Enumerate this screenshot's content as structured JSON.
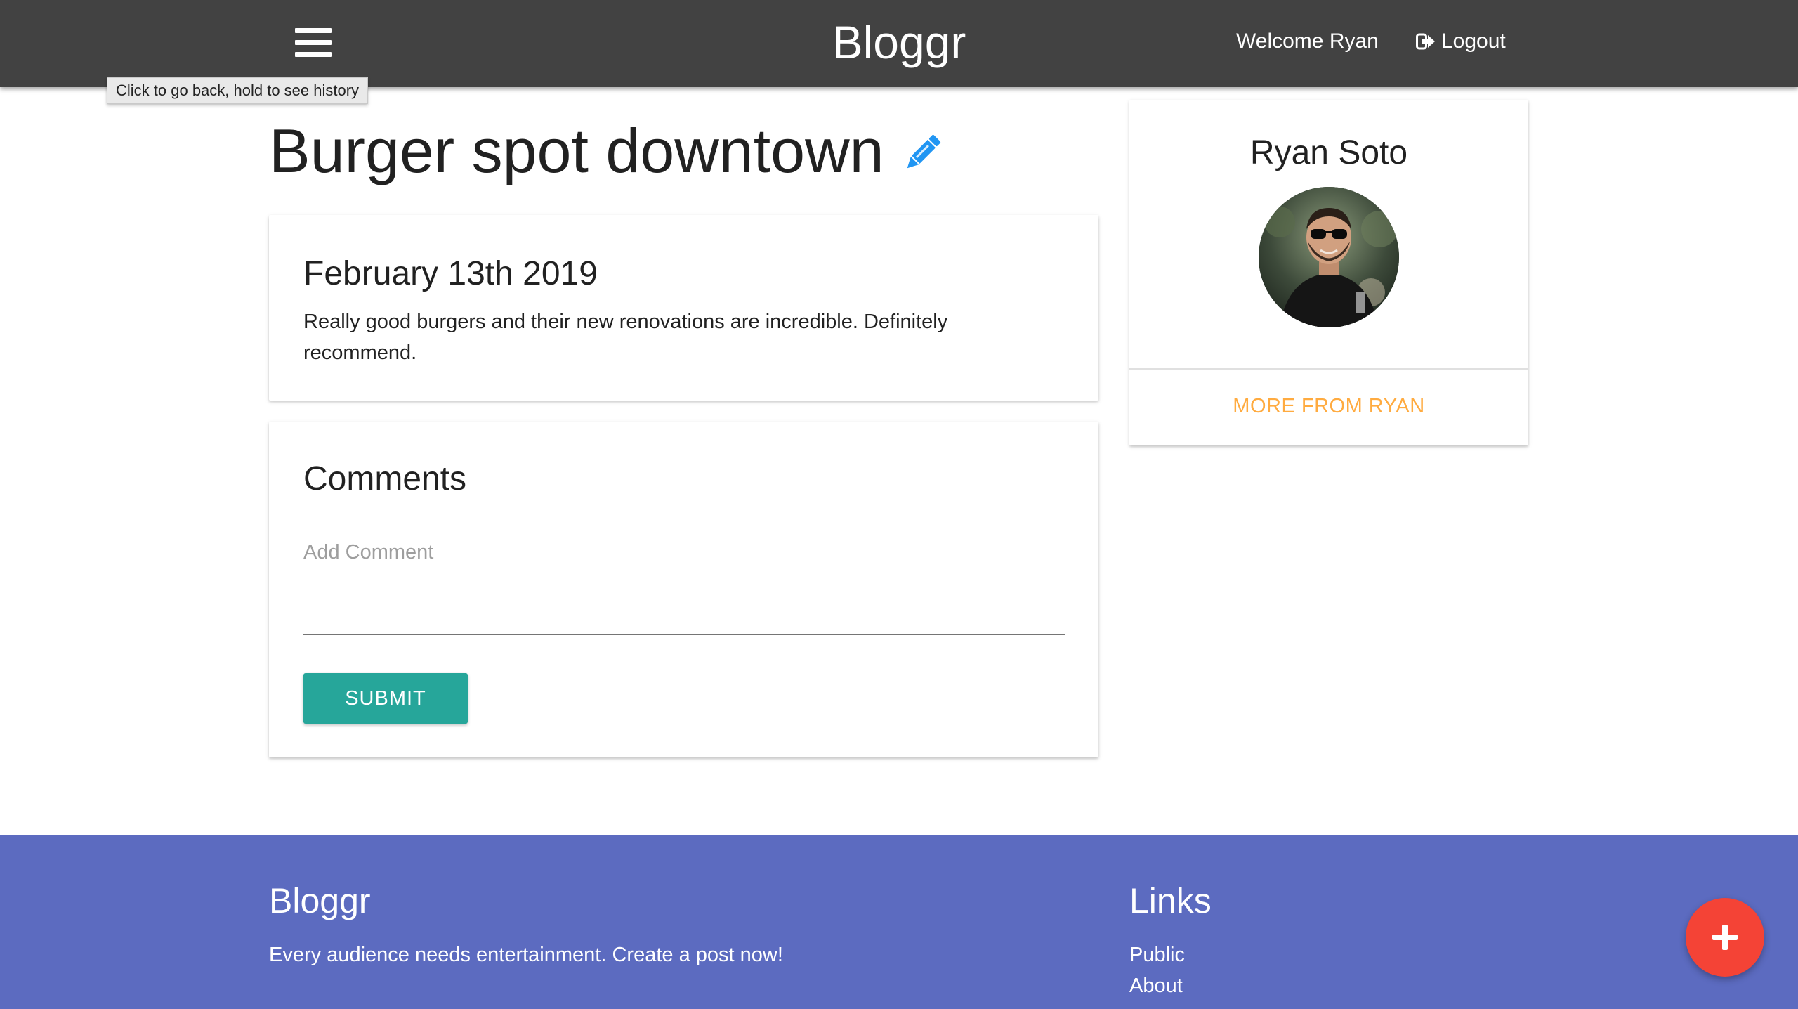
{
  "navbar": {
    "brand": "Bloggr",
    "welcome_text": "Welcome Ryan",
    "logout_label": "Logout",
    "menu_icon": "hamburger-menu-icon",
    "logout_icon": "sign-out-icon",
    "background_color": "#424242"
  },
  "tooltip": {
    "text": "Click to go back, hold to see history"
  },
  "post": {
    "title": "Burger spot downtown",
    "edit_icon": "pencil-icon",
    "date": "February 13th 2019",
    "body": "Really good burgers and their new renovations are incredible. Definitely recommend."
  },
  "comments": {
    "title": "Comments",
    "input_label": "Add Comment",
    "input_value": "",
    "submit_label": "SUBMIT",
    "submit_color": "#26a69a"
  },
  "author": {
    "name": "Ryan Soto",
    "avatar_icon": "profile-photo",
    "more_link": "MORE FROM RYAN",
    "more_link_color": "#ffab40"
  },
  "footer": {
    "brand": "Bloggr",
    "tagline": "Every audience needs entertainment. Create a post now!",
    "links_title": "Links",
    "links": [
      "Public",
      "About"
    ],
    "background_color": "#5c6bc0"
  },
  "fab": {
    "icon": "plus-icon",
    "color": "#f44336"
  }
}
